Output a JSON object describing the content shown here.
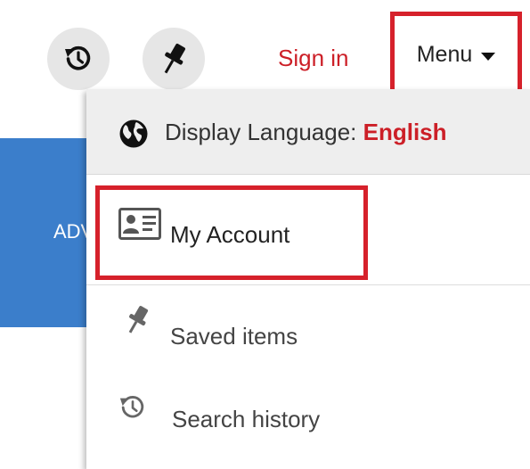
{
  "toolbar": {
    "history_icon": "history-icon",
    "pin_icon": "pin-icon",
    "sign_in_label": "Sign in",
    "menu_label": "Menu"
  },
  "background": {
    "partial_text": "ADV"
  },
  "menu": {
    "display_language_label": "Display Language:",
    "display_language_value": "English",
    "items": [
      {
        "label": "My Account",
        "icon": "account-card-icon"
      },
      {
        "label": "Saved items",
        "icon": "pin-icon"
      },
      {
        "label": "Search history",
        "icon": "history-icon"
      }
    ]
  },
  "colors": {
    "accent_red": "#cc1f27",
    "highlight_border": "#d6212b",
    "blue_panel": "#3b7ecb"
  }
}
